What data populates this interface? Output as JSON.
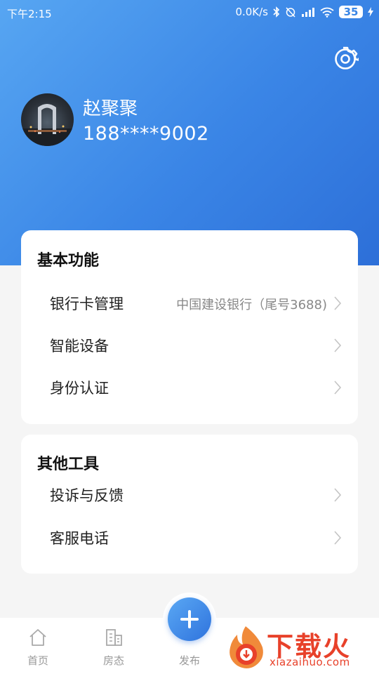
{
  "status_bar": {
    "time": "下午2:15",
    "network_speed": "0.0K/s",
    "battery_level": "35"
  },
  "header": {
    "settings_icon": "gear-icon",
    "user": {
      "name": "赵聚聚",
      "phone": "188****9002"
    }
  },
  "basic_functions": {
    "title": "基本功能",
    "items": [
      {
        "label": "银行卡管理",
        "value": "中国建设银行（尾号3688)"
      },
      {
        "label": "智能设备",
        "value": ""
      },
      {
        "label": "身份认证",
        "value": ""
      }
    ]
  },
  "other_tools": {
    "title": "其他工具",
    "items": [
      {
        "label": "投诉与反馈"
      },
      {
        "label": "客服电话"
      }
    ]
  },
  "tab_bar": {
    "tabs": [
      {
        "label": "首页",
        "icon": "home-icon"
      },
      {
        "label": "房态",
        "icon": "building-icon"
      },
      {
        "label": "发布",
        "icon": "plus-icon"
      }
    ]
  },
  "watermark": {
    "text": "下载火",
    "url": "xiazaihuo.com"
  },
  "colors": {
    "header_gradient_start": "#57a6f2",
    "header_gradient_end": "#2d6fd8",
    "watermark_red": "#e8412a"
  }
}
